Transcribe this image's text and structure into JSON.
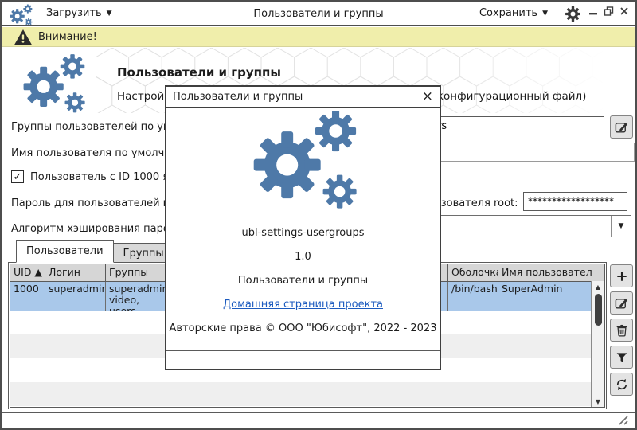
{
  "titlebar": {
    "load_label": "Загрузить",
    "save_label": "Сохранить",
    "title": "Пользователи и группы"
  },
  "warning": {
    "text": "Внимание!"
  },
  "header": {
    "title": "Пользователи и группы",
    "subtitle": "Настройка пользователей и групп (локально или через конфигурационный файл)"
  },
  "form": {
    "default_groups_label": "Группы пользователей по умолчанию (через запятую):",
    "default_groups_value": "audio, video, users",
    "default_username_label": "Имя пользователя по умолчанию (если не задан):",
    "default_username_value": "",
    "uid1000_checkbox_label": "Пользователь с ID 1000 является администратором",
    "default_password_label": "Пароль для пользователей по умолчанию:",
    "root_password_label": "Пароль для пользователя root:",
    "root_password_value": "******************",
    "hash_label": "Алгоритм хэширования пароля:",
    "hash_value": ""
  },
  "tabs": [
    {
      "label": "Пользователи"
    },
    {
      "label": "Группы"
    }
  ],
  "table": {
    "columns": [
      "UID ▲",
      "Логин",
      "Группы",
      "",
      "",
      "Оболочка",
      "Имя пользователя"
    ],
    "rows": [
      {
        "uid": "1000",
        "login": "superadmin",
        "groups": "superadmin, video, users,",
        "shell": "/bin/bash",
        "name": "SuperAdmin"
      }
    ]
  },
  "modal": {
    "title": "Пользователи и группы",
    "app_name": "ubl-settings-usergroups",
    "version": "1.0",
    "description": "Пользователи и группы",
    "link": "Домашняя страница проекта",
    "copyright": "Авторские права © ООО \"Юбисофт\", 2022 - 2023"
  },
  "icons": {
    "dropdown": "▼",
    "check": "✓",
    "close": "×",
    "scroll_up": "▲",
    "scroll_down": "▼"
  },
  "colors": {
    "gear_blue": "#4e79a8",
    "warning_bg": "#f0eeab",
    "selected_row": "#a9c8ea",
    "link": "#1c5bbf"
  }
}
